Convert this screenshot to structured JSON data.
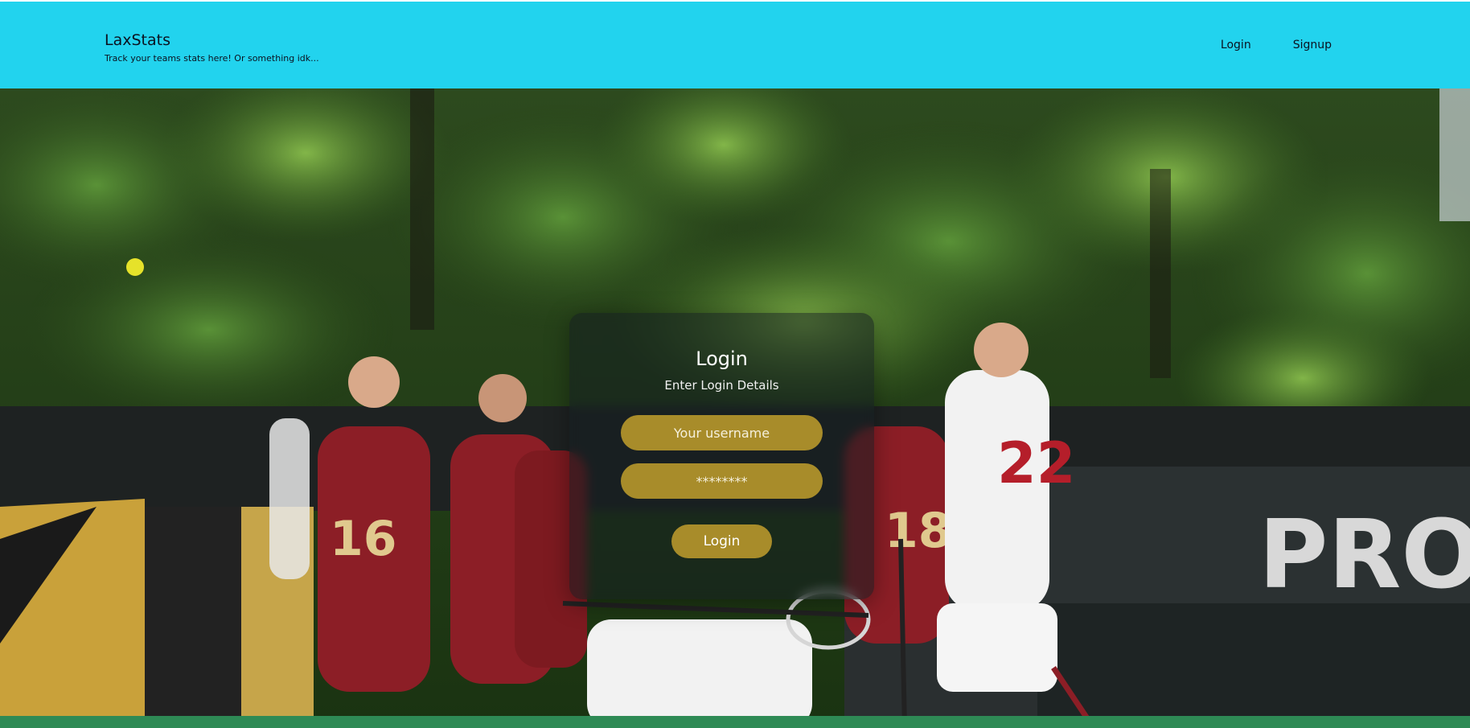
{
  "header": {
    "brand_title": "LaxStats",
    "brand_tagline": "Track your teams stats here! Or something idk...",
    "nav": [
      {
        "label": "Login"
      },
      {
        "label": "Signup"
      }
    ]
  },
  "login_card": {
    "title": "Login",
    "subtitle": "Enter Login Details",
    "username_placeholder": "Your username",
    "password_placeholder": "********",
    "submit_label": "Login"
  },
  "hero_sign_text": "PROT",
  "colors": {
    "header_bg": "#22d3ee",
    "button_gold": "#a88c2a"
  }
}
